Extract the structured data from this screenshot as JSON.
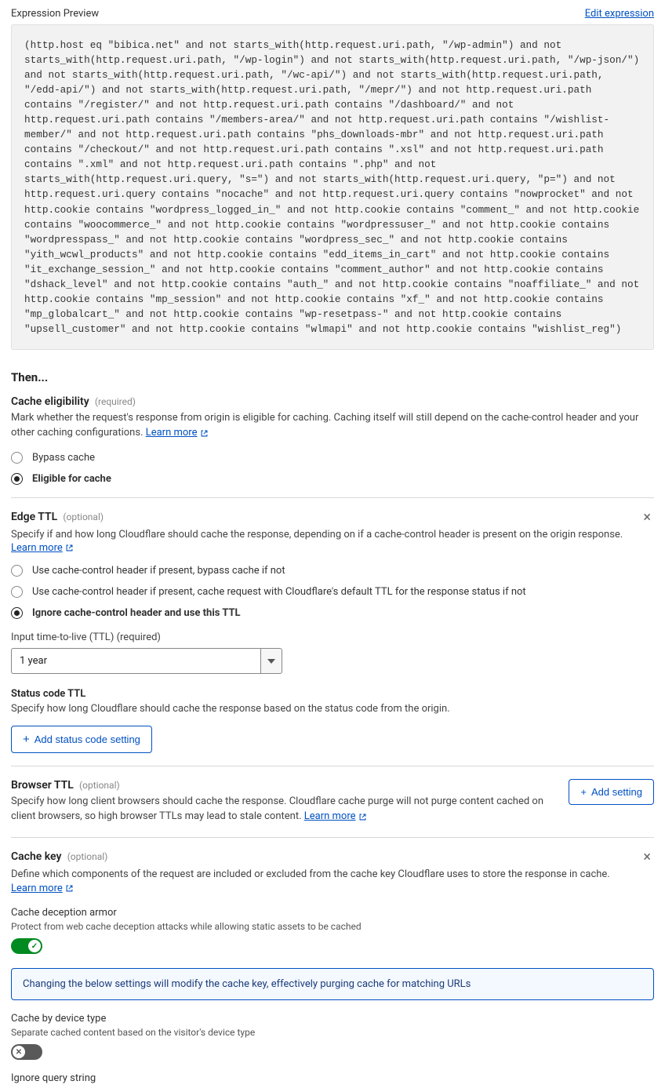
{
  "expression_preview": {
    "label": "Expression Preview",
    "edit_link": "Edit expression",
    "code": "(http.host eq \"bibica.net\" and not starts_with(http.request.uri.path, \"/wp-admin\") and not starts_with(http.request.uri.path, \"/wp-login\") and not starts_with(http.request.uri.path, \"/wp-json/\") and not starts_with(http.request.uri.path, \"/wc-api/\") and not starts_with(http.request.uri.path, \"/edd-api/\") and not starts_with(http.request.uri.path, \"/mepr/\") and not http.request.uri.path contains \"/register/\" and not http.request.uri.path contains \"/dashboard/\" and not http.request.uri.path contains \"/members-area/\" and not http.request.uri.path contains \"/wishlist-member/\" and not http.request.uri.path contains \"phs_downloads-mbr\" and not http.request.uri.path contains \"/checkout/\" and not http.request.uri.path contains \".xsl\" and not http.request.uri.path contains \".xml\" and not http.request.uri.path contains \".php\" and not starts_with(http.request.uri.query, \"s=\") and not starts_with(http.request.uri.query, \"p=\") and not http.request.uri.query contains \"nocache\" and not http.request.uri.query contains \"nowprocket\" and not http.cookie contains \"wordpress_logged_in_\" and not http.cookie contains \"comment_\" and not http.cookie contains \"woocommerce_\" and not http.cookie contains \"wordpressuser_\" and not http.cookie contains \"wordpresspass_\" and not http.cookie contains \"wordpress_sec_\" and not http.cookie contains \"yith_wcwl_products\" and not http.cookie contains \"edd_items_in_cart\" and not http.cookie contains \"it_exchange_session_\" and not http.cookie contains \"comment_author\" and not http.cookie contains \"dshack_level\" and not http.cookie contains \"auth_\" and not http.cookie contains \"noaffiliate_\" and not http.cookie contains \"mp_session\" and not http.cookie contains \"xf_\" and not http.cookie contains \"mp_globalcart_\" and not http.cookie contains \"wp-resetpass-\" and not http.cookie contains \"upsell_customer\" and not http.cookie contains \"wlmapi\" and not http.cookie contains \"wishlist_reg\")"
  },
  "then_label": "Then...",
  "cache_eligibility": {
    "title": "Cache eligibility",
    "badge": "(required)",
    "desc": "Mark whether the request's response from origin is eligible for caching. Caching itself will still depend on the cache-control header and your other caching configurations. ",
    "learn_more": "Learn more",
    "options": {
      "bypass": "Bypass cache",
      "eligible": "Eligible for cache"
    }
  },
  "edge_ttl": {
    "title": "Edge TTL",
    "badge": "(optional)",
    "desc": "Specify if and how long Cloudflare should cache the response, depending on if a cache-control header is present on the origin response.",
    "learn_more": "Learn more",
    "options": {
      "opt1": "Use cache-control header if present, bypass cache if not",
      "opt2": "Use cache-control header if present, cache request with Cloudflare's default TTL for the response status if not",
      "opt3": "Ignore cache-control header and use this TTL"
    },
    "ttl_label": "Input time-to-live (TTL) (required)",
    "ttl_value": "1 year",
    "status_title": "Status code TTL",
    "status_desc": "Specify how long Cloudflare should cache the response based on the status code from the origin.",
    "add_status_btn": "Add status code setting"
  },
  "browser_ttl": {
    "title": "Browser TTL",
    "badge": "(optional)",
    "desc": "Specify how long client browsers should cache the response. Cloudflare cache purge will not purge content cached on client browsers, so high browser TTLs may lead to stale content. ",
    "learn_more": "Learn more",
    "add_btn": "Add setting"
  },
  "cache_key": {
    "title": "Cache key",
    "badge": "(optional)",
    "desc": "Define which components of the request are included or excluded from the cache key Cloudflare uses to store the response in cache.",
    "learn_more": "Learn more",
    "armor_title": "Cache deception armor",
    "armor_desc": "Protect from web cache deception attacks while allowing static assets to be cached",
    "notice": "Changing the below settings will modify the cache key, effectively purging cache for matching URLs",
    "device_title": "Cache by device type",
    "device_desc": "Separate cached content based on the visitor's device type",
    "ignore_title": "Ignore query string"
  }
}
